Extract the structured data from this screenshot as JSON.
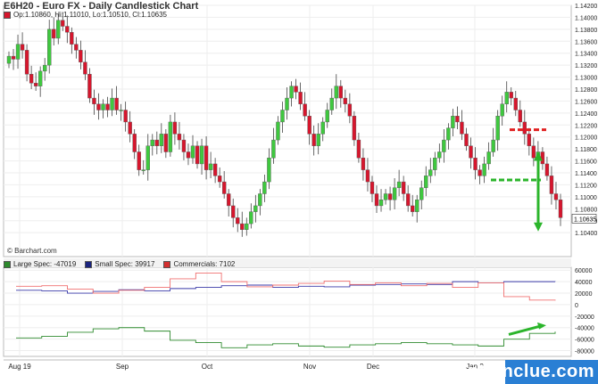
{
  "header": {
    "title": "E6H20 - Euro FX - Daily Candlestick Chart",
    "ohlc": "Op:1.10860, Hi:1.11010, Lo:1.10510, Cl:1.10635",
    "credit": "© Barchart.com",
    "last_price_label": "1.10635"
  },
  "cot_legend": [
    {
      "label": "Large Spec: -47019",
      "color": "#2e8b2e"
    },
    {
      "label": "Small Spec: 39917",
      "color": "#1a237e"
    },
    {
      "label": "Commercials: 7102",
      "color": "#d32f2f"
    }
  ],
  "watermark": "optionclue.com",
  "colors": {
    "up": "#3fc83f",
    "down": "#d6162d",
    "large_spec": "#2e8b2e",
    "small_spec": "#3a3aa8",
    "commercials": "#f07070",
    "annotation": "#2bb52b",
    "resistance": "#e02020"
  },
  "chart_data": [
    {
      "type": "candlestick",
      "title": "E6H20 - Euro FX - Daily Candlestick Chart",
      "x_tick_labels": [
        "Aug 19",
        "Sep",
        "Oct",
        "Nov",
        "Dec",
        "Jan 2"
      ],
      "y_ticks": [
        1.104,
        1.106,
        1.108,
        1.11,
        1.112,
        1.114,
        1.116,
        1.118,
        1.12,
        1.122,
        1.124,
        1.126,
        1.128,
        1.13,
        1.132,
        1.134,
        1.136,
        1.138,
        1.14,
        1.142
      ],
      "y_tick_labels": [
        "1.10400",
        "1.10600",
        "1.10800",
        "1.11000",
        "1.11200",
        "1.11400",
        "1.11600",
        "1.11800",
        "1.12000",
        "1.12200",
        "1.12400",
        "1.12600",
        "1.12800",
        "1.13000",
        "1.13200",
        "1.13400",
        "1.13600",
        "1.13800",
        "1.14000",
        "1.14200"
      ],
      "ylim": [
        1.1,
        1.142
      ],
      "closes": [
        1.1335,
        1.133,
        1.1355,
        1.1345,
        1.1305,
        1.129,
        1.1285,
        1.131,
        1.132,
        1.138,
        1.1365,
        1.1395,
        1.1385,
        1.1375,
        1.1355,
        1.1345,
        1.1325,
        1.1305,
        1.1265,
        1.1255,
        1.1245,
        1.1255,
        1.1245,
        1.1265,
        1.1245,
        1.1245,
        1.1225,
        1.1205,
        1.1175,
        1.1145,
        1.1145,
        1.1185,
        1.1195,
        1.1185,
        1.1205,
        1.1175,
        1.1225,
        1.1205,
        1.1195,
        1.1175,
        1.1165,
        1.1185,
        1.1155,
        1.1185,
        1.1145,
        1.1155,
        1.1135,
        1.1125,
        1.1105,
        1.1085,
        1.1065,
        1.1055,
        1.1045,
        1.1055,
        1.1075,
        1.1085,
        1.1105,
        1.1125,
        1.1165,
        1.1195,
        1.1225,
        1.1245,
        1.1265,
        1.1285,
        1.1275,
        1.1255,
        1.1235,
        1.1205,
        1.1185,
        1.1205,
        1.1225,
        1.1245,
        1.1265,
        1.1285,
        1.1265,
        1.1255,
        1.1235,
        1.1195,
        1.1165,
        1.1145,
        1.1125,
        1.1105,
        1.1085,
        1.1095,
        1.1105,
        1.1095,
        1.1115,
        1.1125,
        1.1105,
        1.1085,
        1.1075,
        1.1095,
        1.1115,
        1.1135,
        1.1145,
        1.1165,
        1.1175,
        1.1195,
        1.1215,
        1.1235,
        1.1225,
        1.1205,
        1.1185,
        1.1165,
        1.1145,
        1.1135,
        1.1155,
        1.1175,
        1.1195,
        1.1235,
        1.1255,
        1.1275,
        1.1265,
        1.1245,
        1.1225,
        1.1205,
        1.1185,
        1.1165,
        1.1175,
        1.1155,
        1.1135,
        1.1105,
        1.1095,
        1.1065
      ],
      "small_spec_legend": "Small Spec: 39917"
    },
    {
      "type": "line",
      "title": "",
      "y_tick_labels": [
        "60000",
        "40000",
        "20000",
        "0",
        "-20000",
        "-40000",
        "-60000",
        "-80000"
      ],
      "ylim": [
        -90000,
        65000
      ],
      "series": [
        {
          "name": "Large Spec: -47019",
          "values": [
            -58000,
            -55000,
            -48000,
            -42000,
            -40000,
            -46000,
            -62000,
            -66000,
            -75000,
            -70000,
            -68000,
            -72000,
            -74000,
            -70000,
            -68000,
            -66000,
            -68000,
            -70000,
            -72000,
            -60000,
            -50000,
            -47019
          ]
        },
        {
          "name": "Small Spec: 39917",
          "values": [
            25000,
            24000,
            20000,
            23000,
            26000,
            24000,
            28000,
            30000,
            33000,
            34000,
            30000,
            32000,
            31000,
            34000,
            35000,
            36000,
            35000,
            40000,
            38000,
            40000,
            40000,
            39917
          ]
        },
        {
          "name": "Commercials: 7102",
          "values": [
            32000,
            33000,
            27000,
            20000,
            25000,
            30000,
            45000,
            55000,
            40000,
            31000,
            34000,
            37000,
            41000,
            35000,
            38000,
            33000,
            37000,
            30000,
            38000,
            14000,
            8000,
            7102
          ]
        }
      ]
    }
  ]
}
